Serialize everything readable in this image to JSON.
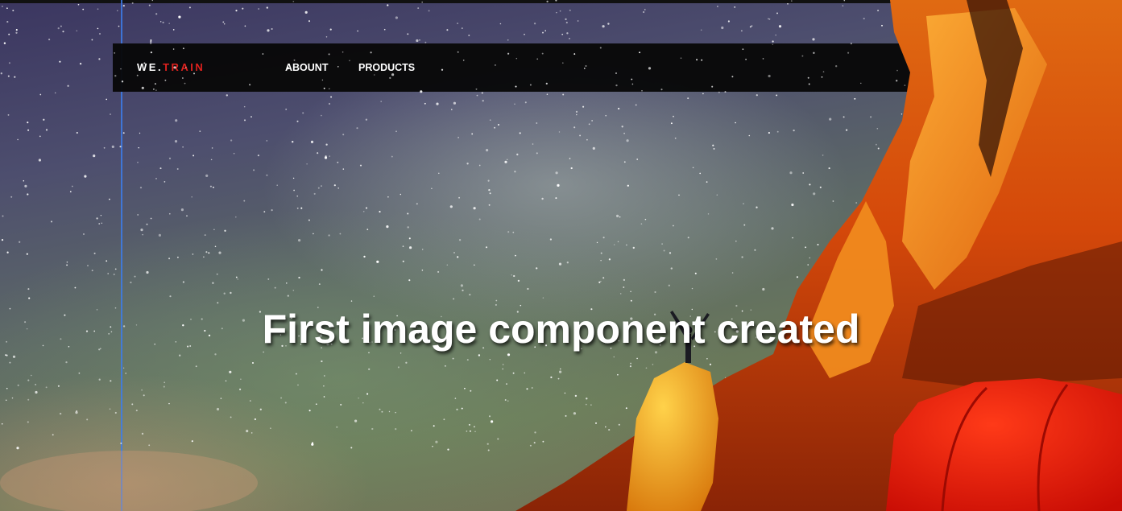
{
  "brand": {
    "prefix": "WE.",
    "suffix": "TRAIN",
    "prefix_color": "#ffffff",
    "suffix_color": "#e0211e"
  },
  "nav": {
    "items": [
      {
        "label": "ABOUNT"
      },
      {
        "label": "PRODUCTS"
      }
    ]
  },
  "hero": {
    "heading": "First image component created",
    "background_description_icons": [
      "starry-sky",
      "rock-cliff",
      "person-silhouette",
      "tent"
    ]
  },
  "colors": {
    "navbar_bg": "#080808",
    "accent": "#e0211e",
    "guide_line": "#3d7dea",
    "rock_orange": "#e8640a",
    "tent_red": "#f01c0a"
  }
}
